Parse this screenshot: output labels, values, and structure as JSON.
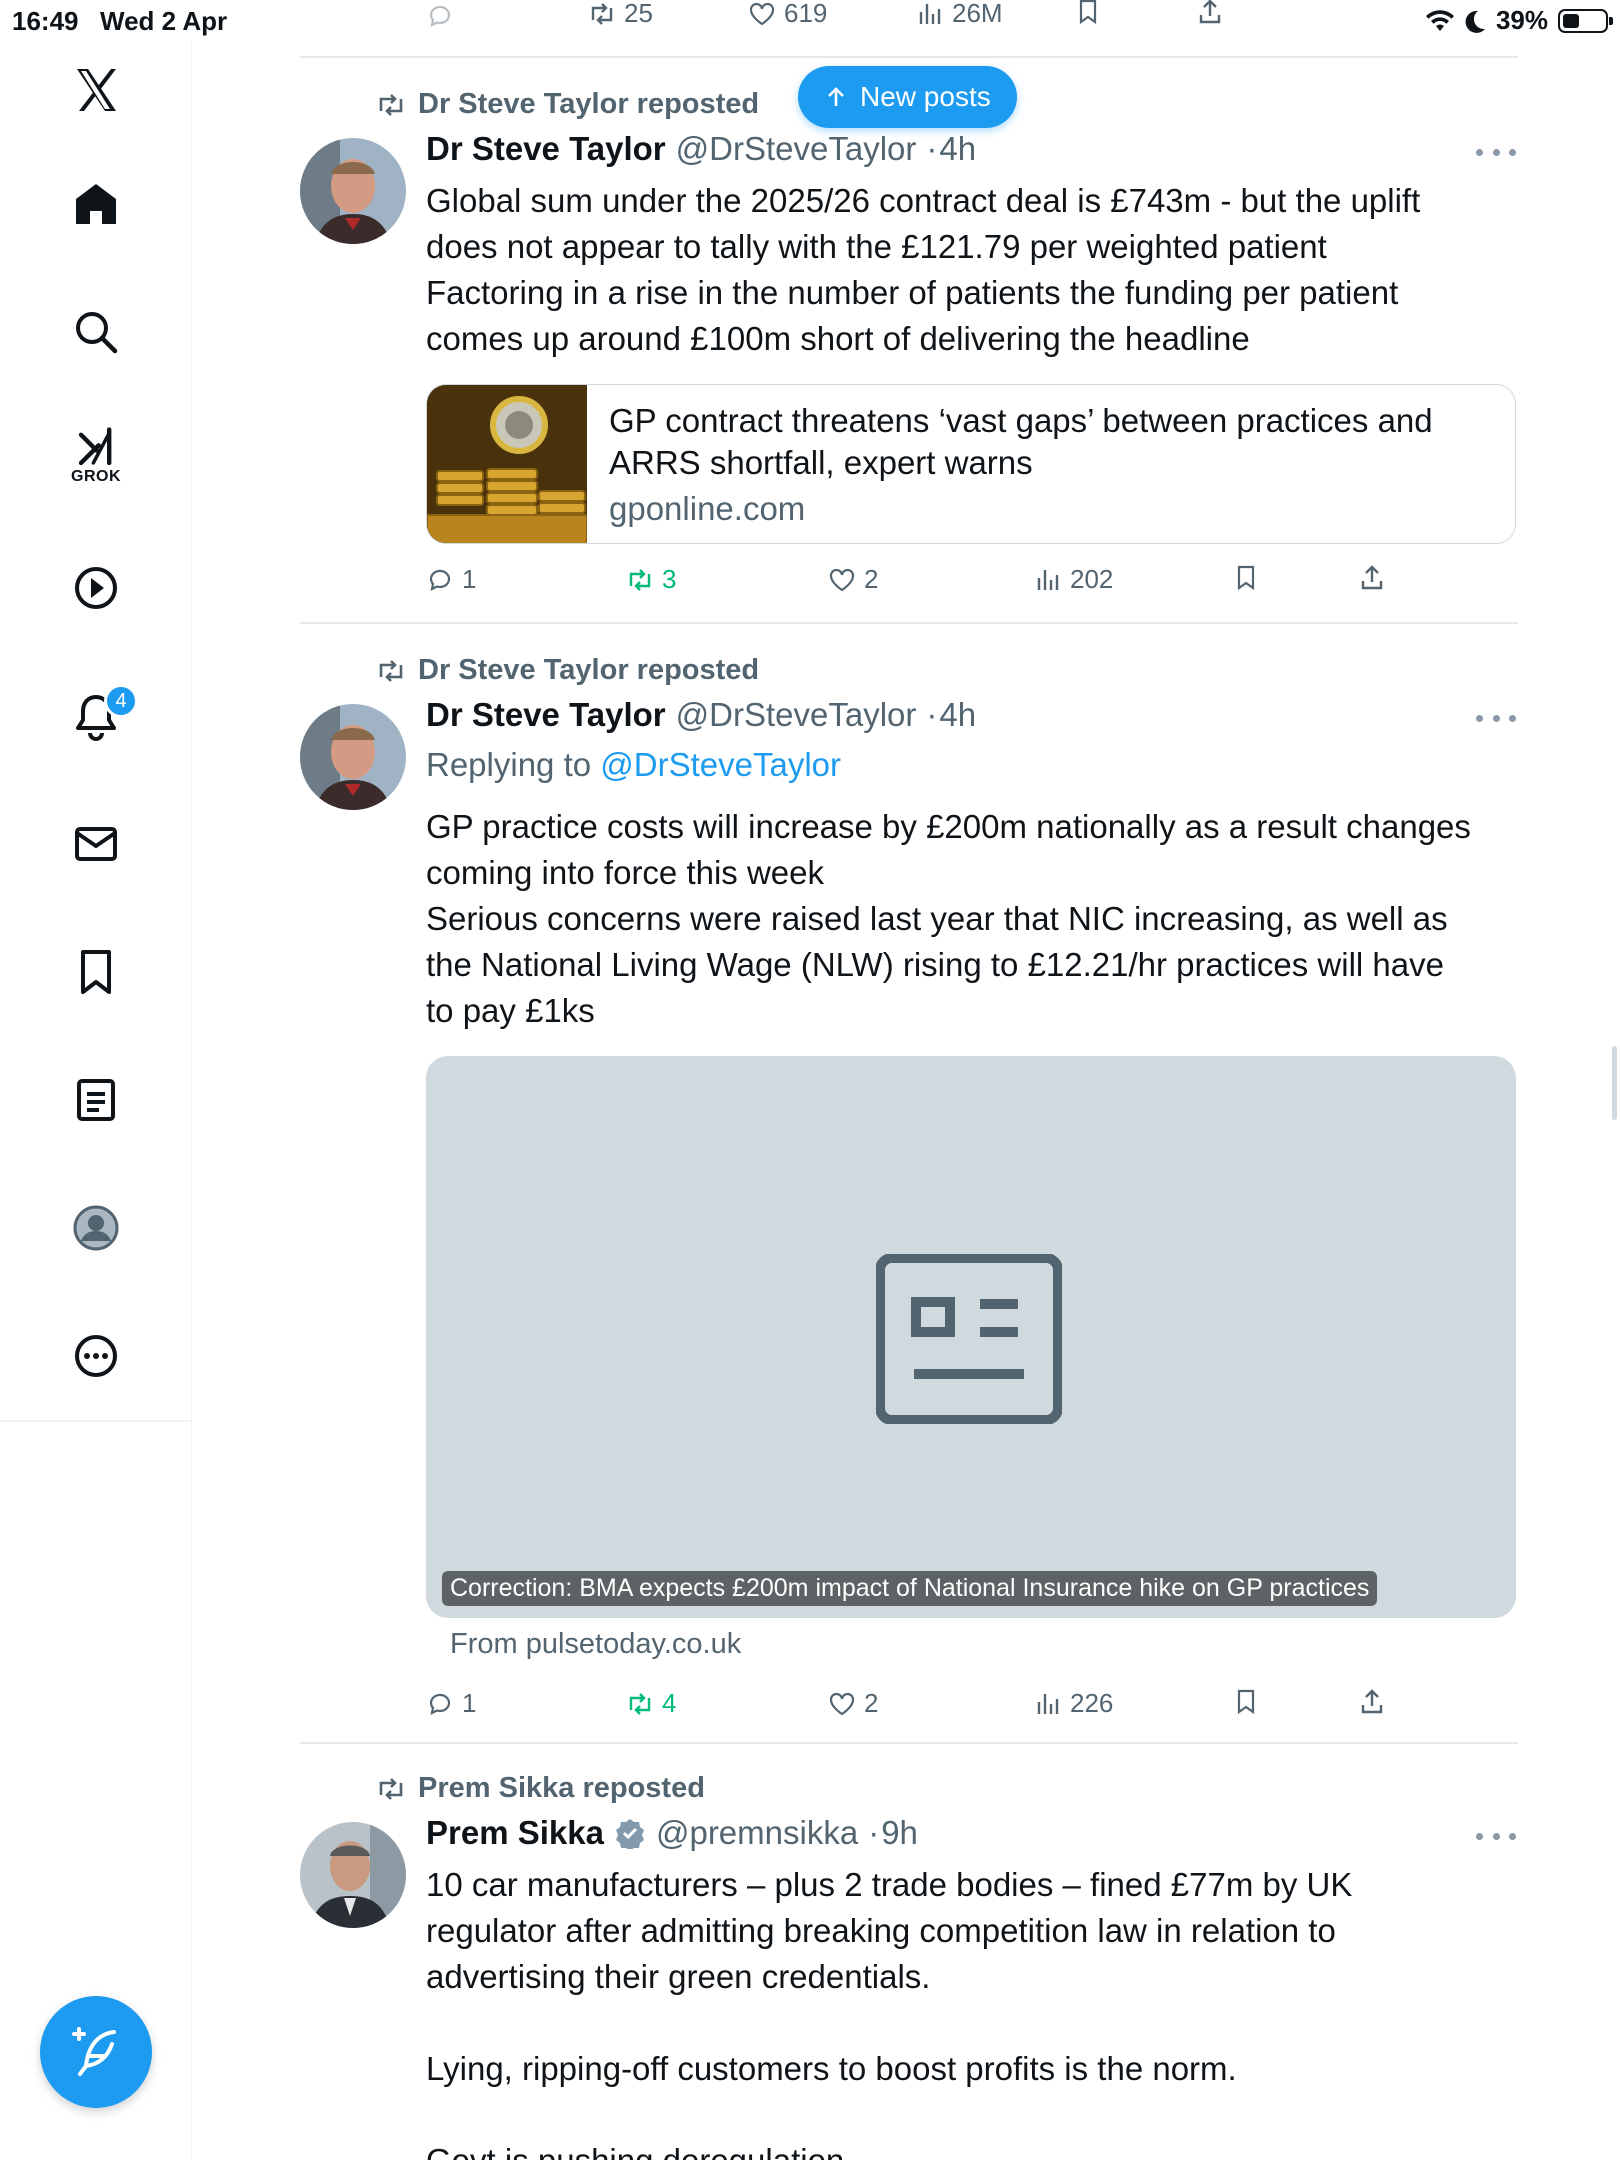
{
  "status_bar": {
    "time": "16:49",
    "date": "Wed 2 Apr",
    "battery_text": "39%",
    "battery_level": 0.39
  },
  "nav": {
    "notifications_badge": "4",
    "grok_label": "GROK",
    "items": [
      "x-logo-icon",
      "home-icon",
      "search-icon",
      "grok-icon",
      "video-icon",
      "bell-icon",
      "mail-icon",
      "bookmark-icon",
      "article-icon",
      "profile-icon",
      "more-icon"
    ]
  },
  "top_actions": {
    "reposts": "25",
    "likes": "619",
    "views": "26M"
  },
  "new_posts_label": "New posts",
  "posts": [
    {
      "repost_by": "Dr Steve Taylor reposted",
      "name": "Dr Steve Taylor",
      "handle": "@DrSteveTaylor",
      "time": "4h",
      "lines": [
        "Global sum under the 2025/26 contract deal is £743m - but the uplift",
        "does not appear to tally with the £121.79 per weighted patient",
        "Factoring in a rise in the number of patients the funding per patient",
        "comes up around £100m short of delivering the headline"
      ],
      "card": {
        "title_lines": [
          "GP contract threatens ‘vast gaps’ between practices and",
          "ARRS shortfall, expert warns"
        ],
        "domain": "gponline.com"
      },
      "actions": {
        "replies": "1",
        "reposts": "3",
        "likes": "2",
        "views": "202"
      }
    },
    {
      "repost_by": "Dr Steve Taylor reposted",
      "name": "Dr Steve Taylor",
      "handle": "@DrSteveTaylor",
      "time": "4h",
      "replying_prefix": "Replying to",
      "replying_handle": "@DrSteveTaylor",
      "lines": [
        "GP practice costs will increase by £200m nationally as a result changes",
        "coming into force this week",
        "Serious concerns were raised last year that NIC increasing, as well as",
        "the National Living Wage (NLW) rising to £12.21/hr practices will have",
        "to pay £1ks"
      ],
      "media_caption": "Correction: BMA expects £200m impact of National Insurance hike on GP practices",
      "from_domain": "From pulsetoday.co.uk",
      "actions": {
        "replies": "1",
        "reposts": "4",
        "likes": "2",
        "views": "226"
      }
    },
    {
      "repost_by": "Prem Sikka reposted",
      "name": "Prem Sikka",
      "handle": "@premnsikka",
      "time": "9h",
      "lines": [
        "10 car manufacturers – plus 2 trade bodies –  fined £77m by UK",
        "regulator after admitting breaking competition law in relation to",
        "advertising their green credentials.",
        "",
        "Lying, ripping-off customers to boost profits is the norm.",
        "",
        "Govt is pushing deregulation"
      ]
    }
  ]
}
